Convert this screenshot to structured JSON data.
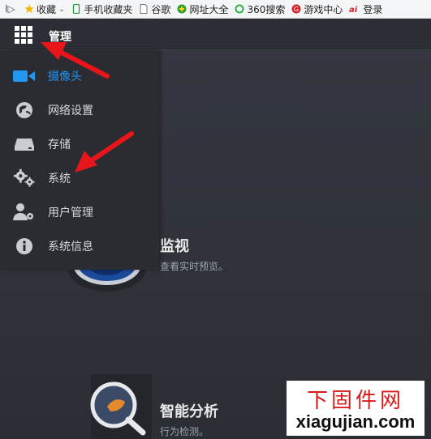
{
  "browser": {
    "bookmarks": [
      {
        "label": "收藏",
        "icon": "star-icon"
      },
      {
        "label": "手机收藏夹",
        "icon": "phone-icon"
      },
      {
        "label": "谷歌",
        "icon": "page-icon"
      },
      {
        "label": "网址大全",
        "icon": "plus-circle-icon"
      },
      {
        "label": "360搜索",
        "icon": "search-360-icon"
      },
      {
        "label": "游戏中心",
        "icon": "game-icon"
      },
      {
        "label": "登录",
        "icon": "ai-icon"
      }
    ],
    "toggle": "I▷"
  },
  "header": {
    "title": "管理"
  },
  "menu": {
    "items": [
      {
        "label": "摄像头",
        "icon": "camera-icon",
        "active": true
      },
      {
        "label": "网络设置",
        "icon": "network-globe-icon",
        "active": false
      },
      {
        "label": "存储",
        "icon": "storage-drive-icon",
        "active": false
      },
      {
        "label": "系统",
        "icon": "gears-icon",
        "active": false
      },
      {
        "label": "用户管理",
        "icon": "user-gear-icon",
        "active": false
      },
      {
        "label": "系统信息",
        "icon": "info-icon",
        "active": false
      }
    ]
  },
  "tiles": [
    {
      "title": "监视",
      "desc": "查看实时预览。"
    },
    {
      "title": "智能分析",
      "desc": "行为检测。"
    }
  ],
  "watermark": {
    "top": "下固件网",
    "bottom": "xiagujian.com"
  },
  "colors": {
    "accent": "#2196f3",
    "arrow": "#e8161b"
  }
}
